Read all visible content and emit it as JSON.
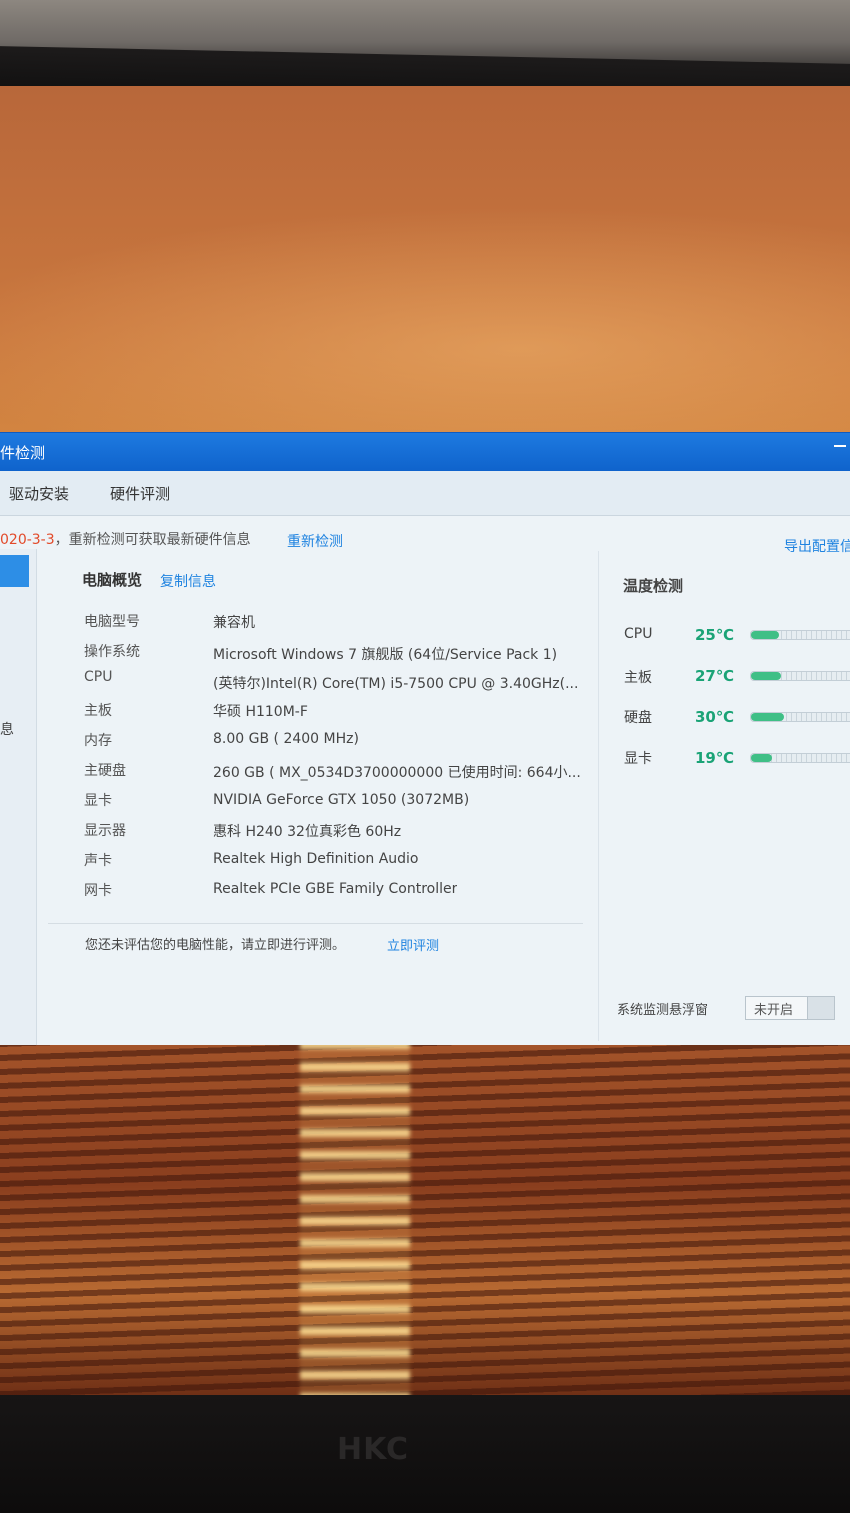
{
  "window": {
    "title": "件检测",
    "tabs": [
      {
        "label": "驱动安装"
      },
      {
        "label": "硬件评测"
      }
    ]
  },
  "notice": {
    "date": "020-3-3",
    "text": "，重新检测可获取最新硬件信息",
    "recheck_link": "重新检测",
    "export_link": "导出配置信"
  },
  "sidebar": {
    "info_label": "息"
  },
  "overview": {
    "title": "电脑概览",
    "copy_link": "复制信息",
    "specs": [
      {
        "label": "电脑型号",
        "value": "兼容机"
      },
      {
        "label": "操作系统",
        "value": "Microsoft Windows 7 旗舰版  (64位/Service Pack 1)"
      },
      {
        "label": "CPU",
        "value": "(英特尔)Intel(R) Core(TM) i5-7500 CPU @ 3.40GHz(..."
      },
      {
        "label": "主板",
        "value": "华硕 H110M-F"
      },
      {
        "label": "内存",
        "value": "8.00 GB (   2400 MHz)"
      },
      {
        "label": "主硬盘",
        "value": "260 GB (  MX_0534D3700000000 已使用时间: 664小..."
      },
      {
        "label": "显卡",
        "value": "NVIDIA GeForce GTX 1050 (3072MB)"
      },
      {
        "label": "显示器",
        "value": "惠科 H240 32位真彩色 60Hz"
      },
      {
        "label": "声卡",
        "value": "Realtek High Definition Audio"
      },
      {
        "label": "网卡",
        "value": "Realtek PCIe GBE Family Controller"
      }
    ],
    "eval_text": "您还未评估您的电脑性能，请立即进行评测。",
    "eval_link": "立即评测"
  },
  "temperature": {
    "title": "温度检测",
    "items": [
      {
        "label": "CPU",
        "value": "25℃",
        "level": 0.25
      },
      {
        "label": "主板",
        "value": "27℃",
        "level": 0.27
      },
      {
        "label": "硬盘",
        "value": "30℃",
        "level": 0.3
      },
      {
        "label": "显卡",
        "value": "19℃",
        "level": 0.19
      }
    ],
    "accent_color": "#1aa376",
    "float_label": "系统监测悬浮窗",
    "float_toggle": "未开启"
  },
  "monitor": {
    "brand": "HKC"
  }
}
